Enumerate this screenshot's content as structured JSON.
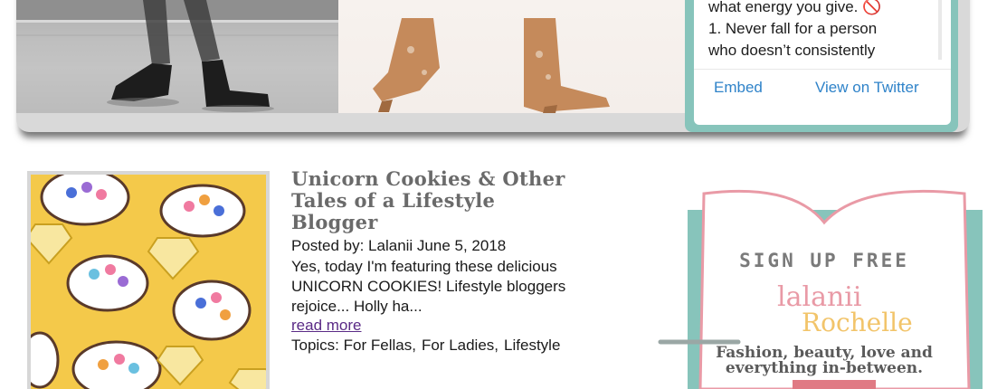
{
  "tweet": {
    "lines": [
      "what energy you give. 🚫",
      "1. Never fall for a person",
      "who doesn’t consistently"
    ],
    "embed_label": "Embed",
    "view_label": "View on Twitter",
    "link_color": "#2f83c9",
    "frame_color": "#87c4bb"
  },
  "post": {
    "title_lines": [
      "Unicorn Cookies & Other",
      "Tales of a Lifestyle",
      "Blogger"
    ],
    "meta": "Posted by: Lalanii June 5, 2018",
    "excerpt_lines": [
      "Yes, today I'm featuring these delicious",
      "UNICORN COOKIES! Lifestyle bloggers",
      "rejoice... Holly ha..."
    ],
    "read_more": "read more",
    "topics_label": "Topics:",
    "topics": [
      "For Fellas",
      "For Ladies",
      "Lifestyle"
    ]
  },
  "signup": {
    "title": "SIGN UP FREE",
    "brand_first": "lalanii",
    "brand_last": "Rochelle",
    "tagline_lines": [
      "Fashion, beauty, love and",
      "everything in-between."
    ],
    "accent_teal": "#87c4bb",
    "accent_pink": "#e99aa6"
  }
}
